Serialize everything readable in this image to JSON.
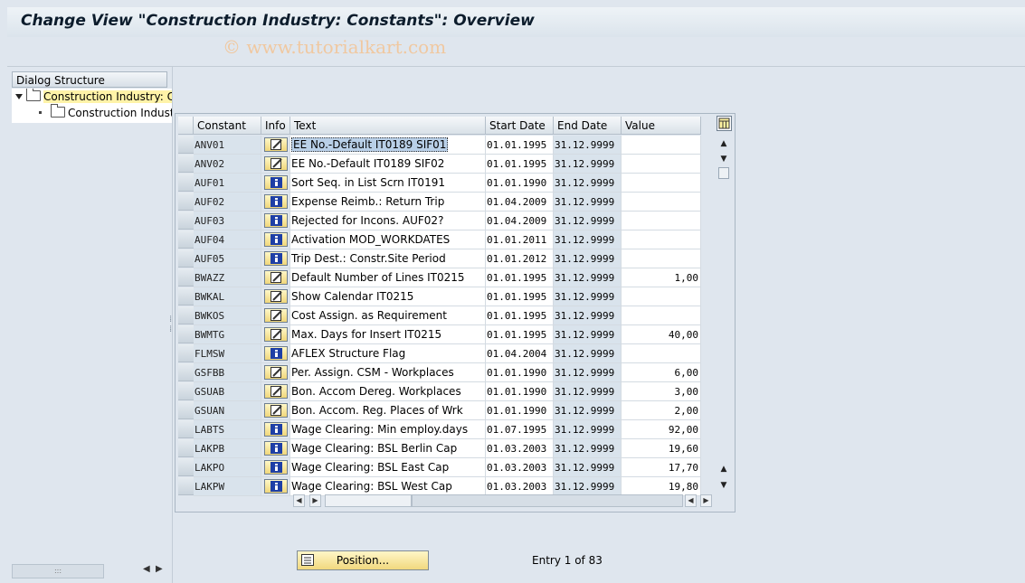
{
  "window": {
    "title": "Change View \"Construction Industry: Constants\": Overview"
  },
  "watermark": "© www.tutorialkart.com",
  "dialog_structure": {
    "header": "Dialog Structure",
    "items": [
      {
        "label": "Construction Industry: C",
        "selected": true
      },
      {
        "label": "Construction Industr",
        "selected": false
      }
    ]
  },
  "table": {
    "columns": [
      "Constant",
      "Info",
      "Text",
      "Start Date",
      "End Date",
      "Value"
    ],
    "rows": [
      {
        "constant": "ANV01",
        "info": "edit-icon",
        "text": "EE No.-Default IT0189 SIF01",
        "start": "01.01.1995",
        "end": "31.12.9999",
        "value": "",
        "highlighted": true
      },
      {
        "constant": "ANV02",
        "info": "edit-icon",
        "text": "EE No.-Default IT0189 SIF02",
        "start": "01.01.1995",
        "end": "31.12.9999",
        "value": ""
      },
      {
        "constant": "AUF01",
        "info": "info-icon",
        "text": "Sort Seq. in List Scrn IT0191",
        "start": "01.01.1990",
        "end": "31.12.9999",
        "value": ""
      },
      {
        "constant": "AUF02",
        "info": "info-icon",
        "text": "Expense Reimb.: Return Trip",
        "start": "01.04.2009",
        "end": "31.12.9999",
        "value": ""
      },
      {
        "constant": "AUF03",
        "info": "info-icon",
        "text": "Rejected for Incons. AUF02?",
        "start": "01.04.2009",
        "end": "31.12.9999",
        "value": ""
      },
      {
        "constant": "AUF04",
        "info": "info-icon",
        "text": "Activation MOD_WORKDATES",
        "start": "01.01.2011",
        "end": "31.12.9999",
        "value": ""
      },
      {
        "constant": "AUF05",
        "info": "info-icon",
        "text": "Trip Dest.: Constr.Site Period",
        "start": "01.01.2012",
        "end": "31.12.9999",
        "value": ""
      },
      {
        "constant": "BWAZZ",
        "info": "edit-icon",
        "text": "Default Number of Lines IT0215",
        "start": "01.01.1995",
        "end": "31.12.9999",
        "value": "1,00"
      },
      {
        "constant": "BWKAL",
        "info": "edit-icon",
        "text": "Show Calendar            IT0215",
        "start": "01.01.1995",
        "end": "31.12.9999",
        "value": ""
      },
      {
        "constant": "BWKOS",
        "info": "edit-icon",
        "text": "Cost Assign. as Requirement",
        "start": "01.01.1995",
        "end": "31.12.9999",
        "value": ""
      },
      {
        "constant": "BWMTG",
        "info": "edit-icon",
        "text": "Max. Days for Insert  IT0215",
        "start": "01.01.1995",
        "end": "31.12.9999",
        "value": "40,00"
      },
      {
        "constant": "FLMSW",
        "info": "info-icon",
        "text": "AFLEX Structure Flag",
        "start": "01.04.2004",
        "end": "31.12.9999",
        "value": ""
      },
      {
        "constant": "GSFBB",
        "info": "edit-icon",
        "text": "Per. Assign. CSM - Workplaces",
        "start": "01.01.1990",
        "end": "31.12.9999",
        "value": "6,00"
      },
      {
        "constant": "GSUAB",
        "info": "edit-icon",
        "text": "Bon. Accom  Dereg. Workplaces",
        "start": "01.01.1990",
        "end": "31.12.9999",
        "value": "3,00"
      },
      {
        "constant": "GSUAN",
        "info": "edit-icon",
        "text": "Bon. Accom. Reg. Places of Wrk",
        "start": "01.01.1990",
        "end": "31.12.9999",
        "value": "2,00"
      },
      {
        "constant": "LABTS",
        "info": "info-icon",
        "text": "Wage Clearing: Min employ.days",
        "start": "01.07.1995",
        "end": "31.12.9999",
        "value": "92,00"
      },
      {
        "constant": "LAKPB",
        "info": "info-icon",
        "text": "Wage Clearing: BSL Berlin Cap",
        "start": "01.03.2003",
        "end": "31.12.9999",
        "value": "19,60"
      },
      {
        "constant": "LAKPO",
        "info": "info-icon",
        "text": "Wage Clearing: BSL East Cap",
        "start": "01.03.2003",
        "end": "31.12.9999",
        "value": "17,70"
      },
      {
        "constant": "LAKPW",
        "info": "info-icon",
        "text": "Wage Clearing: BSL West Cap",
        "start": "01.03.2003",
        "end": "31.12.9999",
        "value": "19,80"
      }
    ]
  },
  "footer": {
    "position_button": "Position...",
    "entry_text": "Entry 1 of 83"
  }
}
